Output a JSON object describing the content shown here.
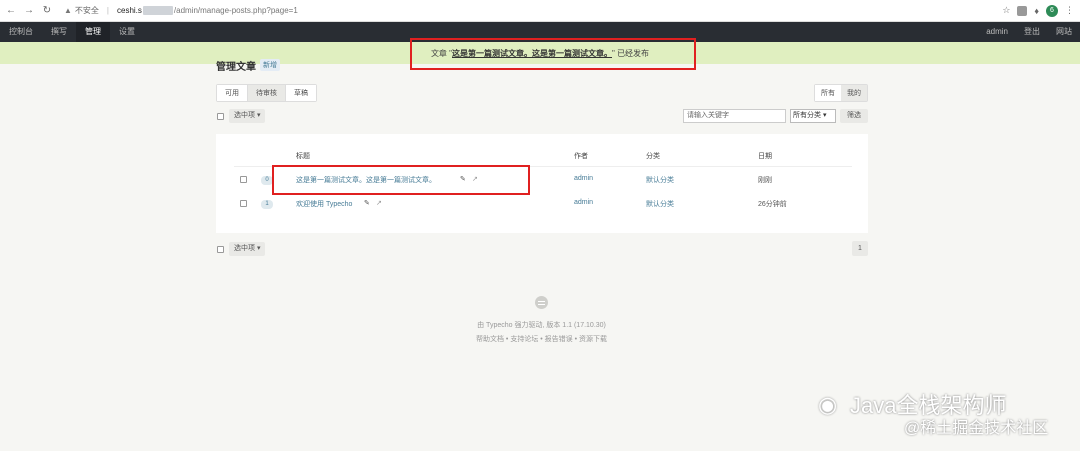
{
  "browser": {
    "not_secure": "不安全",
    "url_host": "ceshi.s",
    "url_path": "/admin/manage-posts.php?page=1",
    "profile_initial": "6"
  },
  "admin_menu": {
    "items": [
      "控制台",
      "撰写",
      "管理",
      "设置"
    ],
    "active": "管理",
    "right": [
      "admin",
      "登出",
      "网站"
    ]
  },
  "notice": {
    "prefix": "文章 \"",
    "title": "这是第一篇测试文章。这是第一篇测试文章。",
    "suffix": "\" 已经发布"
  },
  "page": {
    "title": "管理文章",
    "new_label": "新增"
  },
  "status_tabs": [
    "可用",
    "待审核",
    "草稿"
  ],
  "scope_tabs": [
    "所有",
    "我的"
  ],
  "ops": {
    "selected_label": "选中项",
    "search_placeholder": "请输入关键字",
    "category_select": "所有分类",
    "filter_button": "筛选"
  },
  "table": {
    "headers": [
      "标题",
      "作者",
      "分类",
      "日期"
    ],
    "rows": [
      {
        "comments": "0",
        "title": "这是第一篇测试文章。这是第一篇测试文章。",
        "author": "admin",
        "category": "默认分类",
        "date": "刚刚"
      },
      {
        "comments": "1",
        "title": "欢迎使用 Typecho",
        "author": "admin",
        "category": "默认分类",
        "date": "26分钟前"
      }
    ]
  },
  "pagination": {
    "current": "1"
  },
  "footer": {
    "line1": "由 Typecho 强力驱动, 版本 1.1 (17.10.30)",
    "line2": "帮助文档 • 支持论坛 • 报告错误 • 资源下载"
  },
  "watermark": {
    "line1": "Java全栈架构师",
    "line2": "@稀土掘金技术社区"
  },
  "colors": {
    "admin_bar": "#292d33",
    "notice_bg": "#e0efc0",
    "link": "#467b96",
    "highlight": "#e02020"
  }
}
